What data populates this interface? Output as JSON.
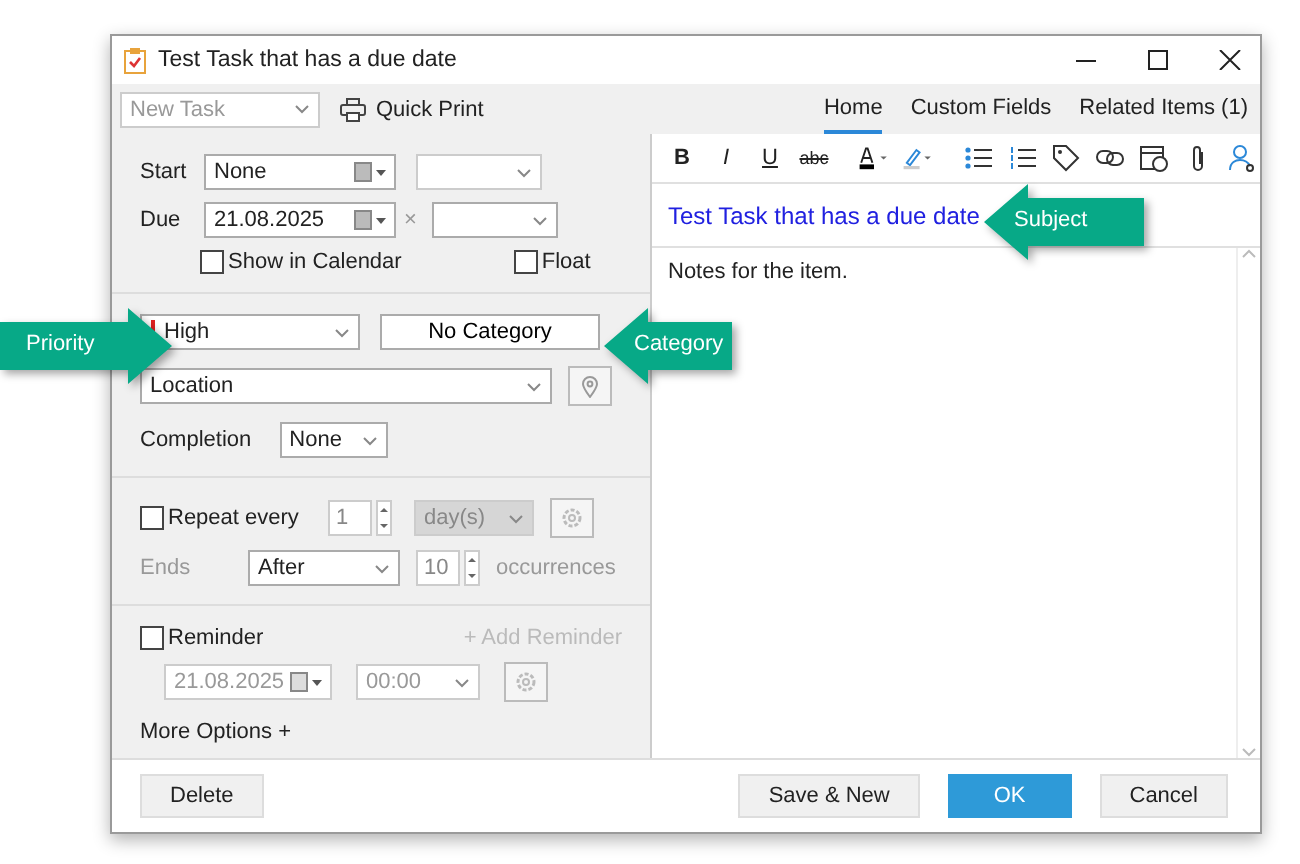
{
  "window": {
    "title": "Test Task that has a due date"
  },
  "toolbar": {
    "template": {
      "value": "New Task",
      "disabled": true
    },
    "quick_print": "Quick Print",
    "tabs": [
      {
        "label": "Home",
        "selected": true
      },
      {
        "label": "Custom Fields",
        "selected": false
      },
      {
        "label": "Related Items  (1)",
        "selected": false
      }
    ]
  },
  "form": {
    "start": {
      "label": "Start",
      "date": "None"
    },
    "due": {
      "label": "Due",
      "date": "21.08.2025",
      "clear": "×"
    },
    "show_in_calendar": {
      "label": "Show in Calendar",
      "checked": false
    },
    "float": {
      "label": "Float",
      "checked": false
    },
    "priority": "High",
    "category": "No Category",
    "location": {
      "placeholder": "Location"
    },
    "completion": {
      "label": "Completion",
      "value": "None"
    },
    "repeat": {
      "label": "Repeat every",
      "checked": false,
      "interval": "1",
      "unit": "day(s)",
      "unit_disabled": true
    },
    "ends": {
      "label": "Ends",
      "mode": "After",
      "count": "10",
      "suffix": "occurrences",
      "disabled": true
    },
    "reminder": {
      "label": "Reminder",
      "checked": false,
      "add": "+ Add Reminder",
      "date": "21.08.2025",
      "time": "00:00",
      "disabled": true
    },
    "more_options": "More Options +"
  },
  "editor": {
    "format_buttons": [
      {
        "kind": "text",
        "label": "B"
      },
      {
        "kind": "text",
        "label": "I"
      },
      {
        "kind": "text",
        "label": "U"
      },
      {
        "kind": "text",
        "label": "abc"
      },
      {
        "kind": "font-color"
      },
      {
        "kind": "highlight"
      },
      {
        "kind": "bullets"
      },
      {
        "kind": "numbering"
      },
      {
        "kind": "tag"
      },
      {
        "kind": "link"
      },
      {
        "kind": "calendar"
      },
      {
        "kind": "attach"
      },
      {
        "kind": "contact"
      }
    ],
    "subject": "Test Task that has a due date",
    "notes": "Notes for the item."
  },
  "buttons": [
    {
      "label": "Delete",
      "primary": false
    },
    {
      "label": "Save & New",
      "primary": false
    },
    {
      "label": "OK",
      "primary": true
    },
    {
      "label": "Cancel",
      "primary": false
    }
  ],
  "callouts": [
    {
      "text": "Priority"
    },
    {
      "text": "Category"
    },
    {
      "text": "Subject"
    }
  ]
}
